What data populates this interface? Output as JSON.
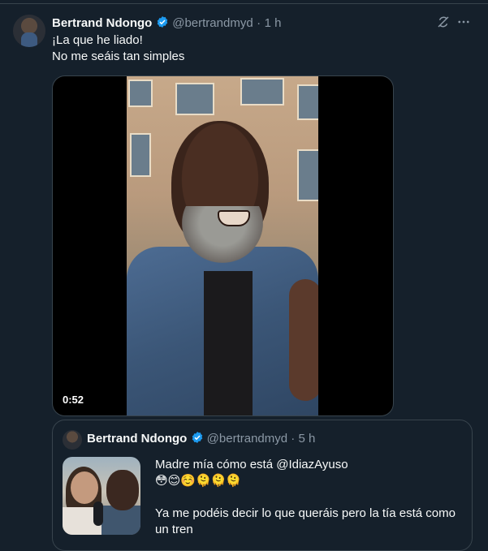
{
  "tweet": {
    "author_name": "Bertrand Ndongo",
    "handle": "@bertrandmyd",
    "separator": "·",
    "time": "1 h",
    "text_line1": "¡La que he liado!",
    "text_line2": "No me seáis tan simples"
  },
  "media": {
    "duration": "0:52"
  },
  "quote": {
    "author_name": "Bertrand Ndongo",
    "handle": "@bertrandmyd",
    "separator": "·",
    "time": "5 h",
    "text_line1": "Madre mía cómo está @IdiazAyuso",
    "text_line2": "😳😊☺️🫠🫠🫠",
    "text_line3": "Ya me podéis decir lo que queráis pero la tía está como un tren"
  },
  "icons": {
    "verified": "verified-badge-icon",
    "grok": "grok-icon",
    "more": "more-icon"
  },
  "colors": {
    "background": "#15202b",
    "border": "#38444d",
    "secondary_text": "#8b98a5",
    "verified_blue": "#1d9bf0"
  }
}
